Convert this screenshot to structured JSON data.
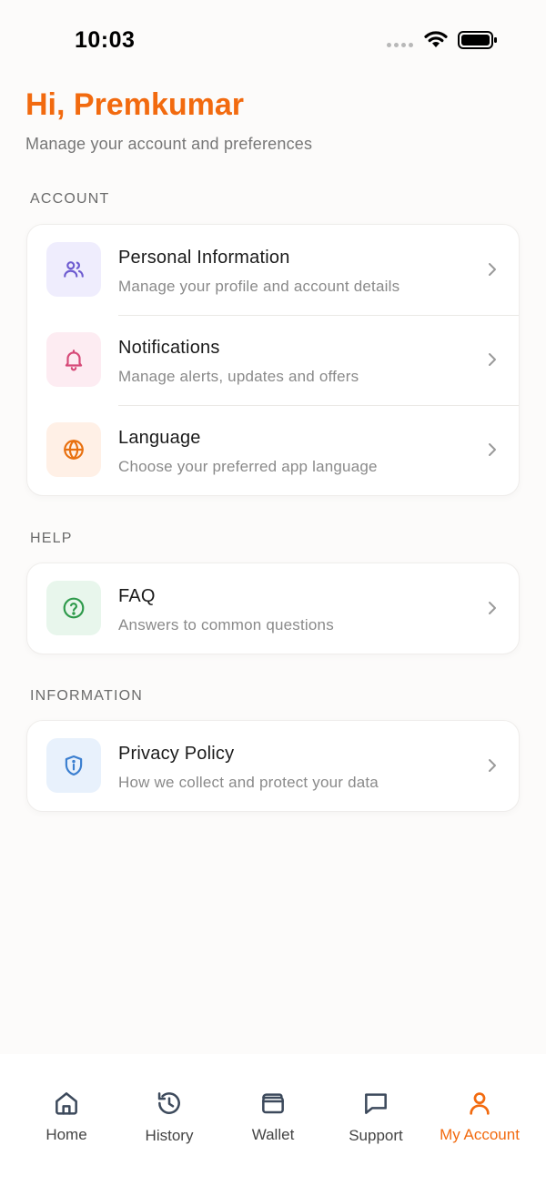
{
  "status_bar": {
    "time": "10:03"
  },
  "header": {
    "greeting": "Hi, Premkumar",
    "subtitle": "Manage your account and preferences"
  },
  "sections": {
    "account": {
      "label": "ACCOUNT",
      "items": [
        {
          "title": "Personal Information",
          "desc": "Manage your profile and account details",
          "icon": "users-icon",
          "icon_bg": "#efedfd",
          "icon_color": "#6d5bd0"
        },
        {
          "title": "Notifications",
          "desc": "Manage alerts, updates and offers",
          "icon": "bell-icon",
          "icon_bg": "#fdecf2",
          "icon_color": "#d64a78"
        },
        {
          "title": "Language",
          "desc": "Choose your preferred app language",
          "icon": "globe-icon",
          "icon_bg": "#fff0e6",
          "icon_color": "#e8700f"
        }
      ]
    },
    "help": {
      "label": "HELP",
      "items": [
        {
          "title": "FAQ",
          "desc": "Answers to common questions",
          "icon": "help-circle-icon",
          "icon_bg": "#e8f6ec",
          "icon_color": "#2e9a4b"
        }
      ]
    },
    "information": {
      "label": "INFORMATION",
      "items": [
        {
          "title": "Privacy Policy",
          "desc": "How we collect and protect your data",
          "icon": "shield-icon",
          "icon_bg": "#e8f1fc",
          "icon_color": "#3b7fd0"
        }
      ]
    }
  },
  "bottom_nav": {
    "items": [
      {
        "label": "Home",
        "icon": "home-icon"
      },
      {
        "label": "History",
        "icon": "history-icon"
      },
      {
        "label": "Wallet",
        "icon": "wallet-icon"
      },
      {
        "label": "Support",
        "icon": "chat-icon"
      },
      {
        "label": "My Account",
        "icon": "user-icon",
        "active": true
      }
    ]
  },
  "colors": {
    "accent": "#f26a0f",
    "background": "#fcfbfa"
  }
}
